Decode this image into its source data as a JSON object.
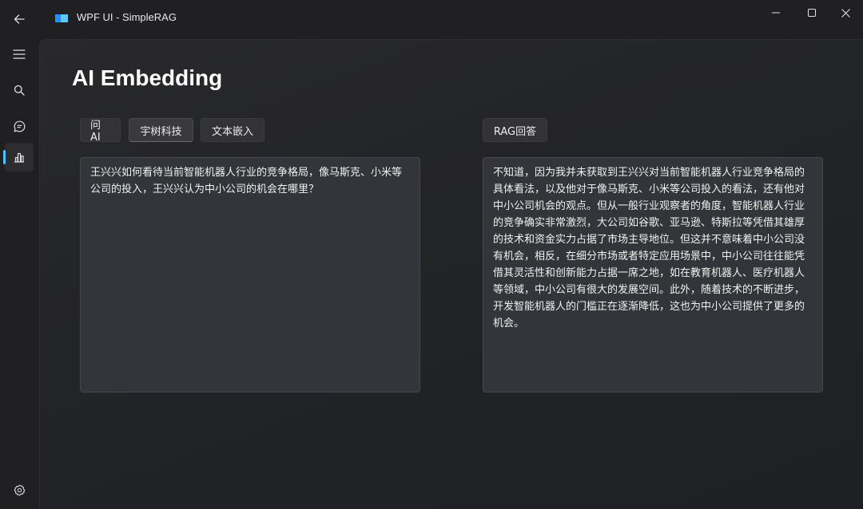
{
  "window": {
    "title": "WPF UI - SimpleRAG"
  },
  "nav": {
    "items": [
      {
        "icon": "hamburger-menu-icon"
      },
      {
        "icon": "search-icon"
      },
      {
        "icon": "chat-icon"
      },
      {
        "icon": "chart-icon",
        "active": true
      }
    ],
    "settings_icon": "gear-icon"
  },
  "page": {
    "title": "AI Embedding"
  },
  "buttons": {
    "ask_ai": "问AI",
    "yushu": "宇树科技",
    "text_embed": "文本嵌入",
    "rag_answer": "RAG回答"
  },
  "question": {
    "value": "王兴兴如何看待当前智能机器人行业的竞争格局，像马斯克、小米等公司的投入，王兴兴认为中小公司的机会在哪里？"
  },
  "answer": {
    "value": "不知道，因为我并未获取到王兴兴对当前智能机器人行业竞争格局的具体看法，以及他对于像马斯克、小米等公司投入的看法，还有他对中小公司机会的观点。但从一般行业观察者的角度，智能机器人行业的竞争确实非常激烈，大公司如谷歌、亚马逊、特斯拉等凭借其雄厚的技术和资金实力占据了市场主导地位。但这并不意味着中小公司没有机会，相反，在细分市场或者特定应用场景中，中小公司往往能凭借其灵活性和创新能力占据一席之地，如在教育机器人、医疗机器人等领域，中小公司有很大的发展空间。此外，随着技术的不断进步，开发智能机器人的门槛正在逐渐降低，这也为中小公司提供了更多的机会。"
  },
  "colors": {
    "accent": "#4cc2ff",
    "background": "#1f1f21",
    "textbox": "#33353a"
  }
}
